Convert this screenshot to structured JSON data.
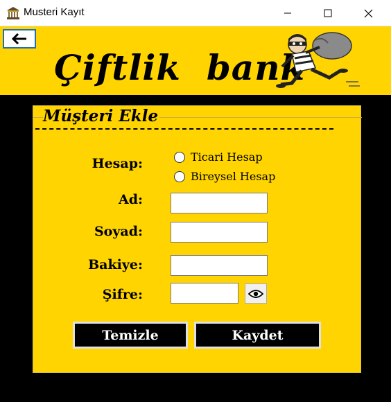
{
  "window": {
    "title": "Musteri Kayıt",
    "app_icon": "bank-icon",
    "controls": [
      "minimize-icon",
      "maximize-icon",
      "close-icon"
    ]
  },
  "header": {
    "back_icon": "arrow-left-icon",
    "brand": "Çiftlik  bank",
    "mascot": "thief-with-sack-image",
    "background": "#ffd400"
  },
  "form": {
    "title": "Müşteri Ekle",
    "divider": "--------------------------------------------",
    "hesap_label": "Hesap:",
    "account_options": [
      "Ticari Hesap",
      "Bireysel Hesap"
    ],
    "ad_label": "Ad:",
    "ad_value": "",
    "soyad_label": "Soyad:",
    "soyad_value": "",
    "bakiye_label": "Bakiye:",
    "bakiye_value": "",
    "sifre_label": "Şifre:",
    "sifre_value": "",
    "show_password_icon": "eye-icon",
    "clear_label": "Temizle",
    "save_label": "Kaydet"
  }
}
